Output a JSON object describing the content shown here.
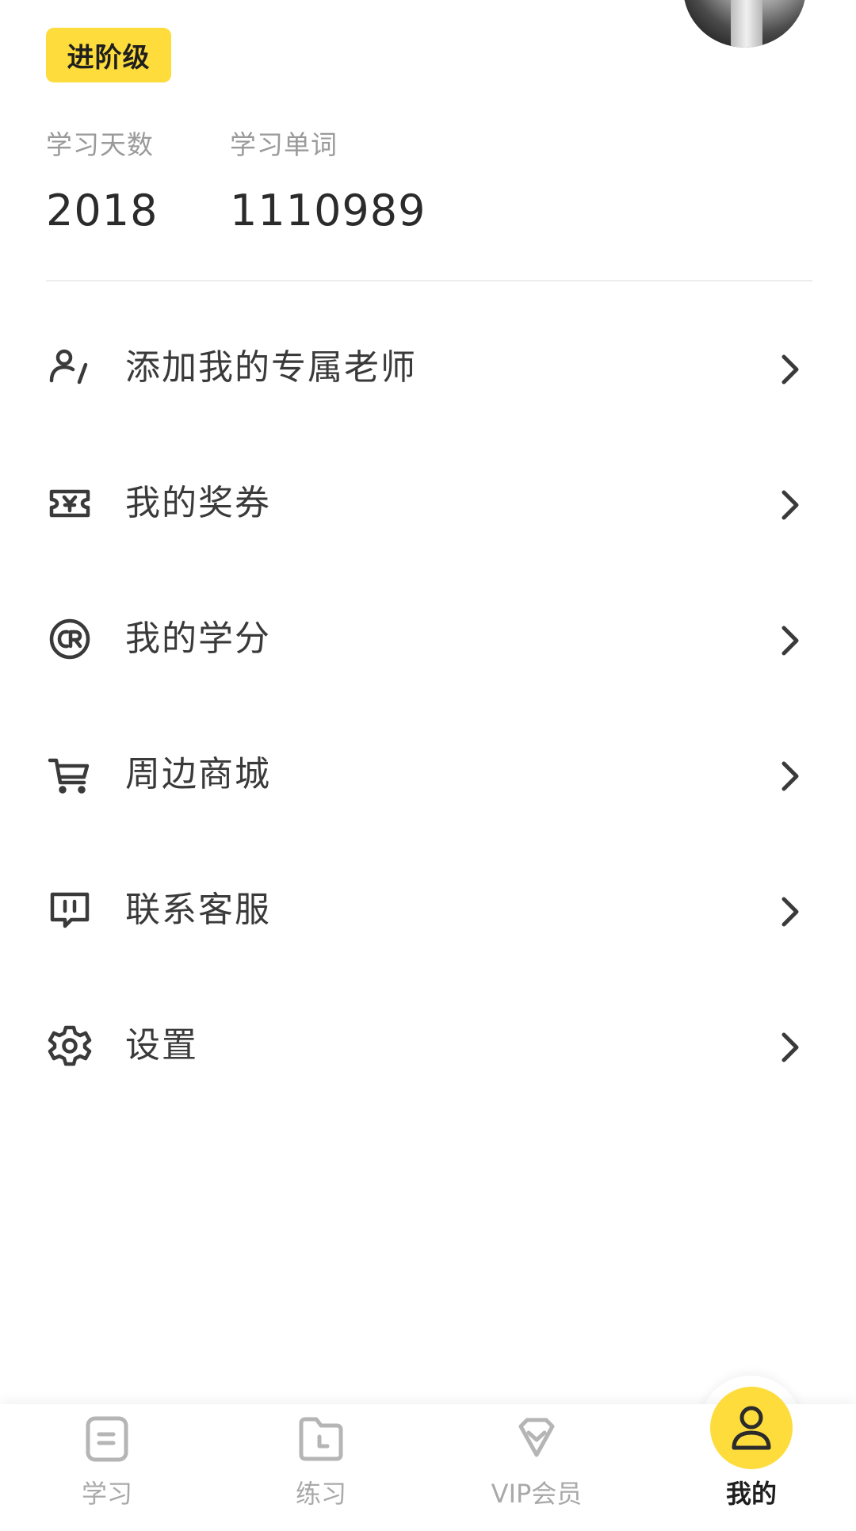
{
  "profile": {
    "level_badge": "进阶级",
    "stats": [
      {
        "label": "学习天数",
        "value": "2018"
      },
      {
        "label": "学习单词",
        "value": "1110989"
      }
    ]
  },
  "menu": {
    "items": [
      {
        "label": "添加我的专属老师",
        "icon": "teacher-icon"
      },
      {
        "label": "我的奖券",
        "icon": "ticket-icon"
      },
      {
        "label": "我的学分",
        "icon": "credit-icon"
      },
      {
        "label": "周边商城",
        "icon": "cart-icon"
      },
      {
        "label": "联系客服",
        "icon": "chat-icon"
      },
      {
        "label": "设置",
        "icon": "gear-icon"
      }
    ],
    "chevron_icon": "chevron-right-icon"
  },
  "tabbar": {
    "active": "我的",
    "tabs": [
      {
        "label": "学习",
        "icon": "study-icon"
      },
      {
        "label": "练习",
        "icon": "practice-icon"
      },
      {
        "label": "VIP会员",
        "icon": "vip-icon"
      },
      {
        "label": "我的",
        "icon": "user-icon"
      }
    ]
  },
  "colors": {
    "accent": "#fddc3c",
    "text_primary": "#333333",
    "text_muted": "#9a9a9a",
    "tab_inactive": "#a9a9a9",
    "divider": "#ececec"
  }
}
